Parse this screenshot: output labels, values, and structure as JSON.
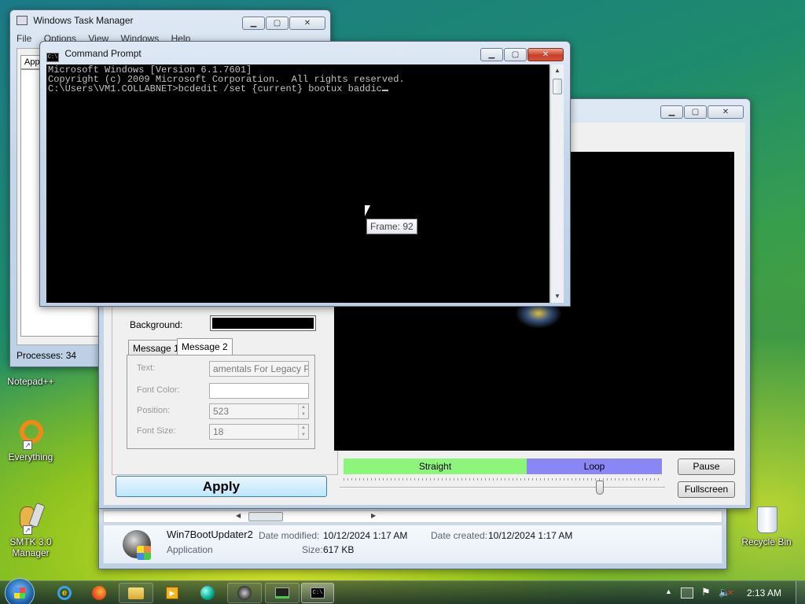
{
  "desktop": {
    "icons": [
      {
        "label": "Notepad++"
      },
      {
        "label": "Everything"
      },
      {
        "label": "SMTK 3.0 Manager"
      },
      {
        "label": "Recycle Bin"
      }
    ]
  },
  "task_manager": {
    "title": "Windows Task Manager",
    "menu": [
      "File",
      "Options",
      "View",
      "Windows",
      "Help"
    ],
    "tab_label": "App",
    "status": "Processes: 34"
  },
  "boot_updater": {
    "background_label": "Background:",
    "background_color": "#000000",
    "tabs": [
      "Message 1",
      "Message 2"
    ],
    "selected_tab": "Message 2",
    "text_label": "Text:",
    "text_value": "amentals For Legacy PCS",
    "font_color_label": "Font Color:",
    "font_color_value": "",
    "position_label": "Position:",
    "position_value": "523",
    "font_size_label": "Font Size:",
    "font_size_value": "18",
    "apply_label": "Apply",
    "straight_label": "Straight",
    "loop_label": "Loop",
    "pause_label": "Pause",
    "fullscreen_label": "Fullscreen",
    "slider_level": 0.8,
    "frame_tooltip": "Frame: 92",
    "colors": {
      "straight": "#8cf57a",
      "loop": "#8a86f5"
    }
  },
  "explorer_details": {
    "file_name": "Win7BootUpdater2",
    "file_type": "Application",
    "date_modified_label": "Date modified:",
    "date_modified_value": "10/12/2024 1:17 AM",
    "date_created_label": "Date created:",
    "date_created_value": "10/12/2024 1:17 AM",
    "size_label": "Size:",
    "size_value": "617 KB"
  },
  "cmd": {
    "title": "Command Prompt",
    "lines": [
      "Microsoft Windows [Version 6.1.7601]",
      "Copyright (c) 2009 Microsoft Corporation.  All rights reserved.",
      "",
      "C:\\Users\\VM1.COLLABNET>bcdedit /set {current} bootux baddic"
    ]
  },
  "taskbar": {
    "clock": "2:13 AM",
    "items": [
      "start-orb",
      "internet-explorer",
      "firefox",
      "windows-explorer",
      "media-player",
      "browser",
      "paint-app",
      "task-manager",
      "command-prompt"
    ]
  }
}
